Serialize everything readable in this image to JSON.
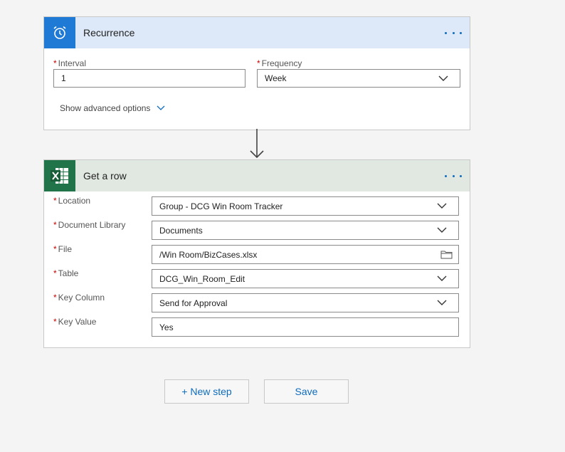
{
  "recurrence": {
    "title": "Recurrence",
    "interval_label": "Interval",
    "interval_value": "1",
    "frequency_label": "Frequency",
    "frequency_value": "Week",
    "advanced_link": "Show advanced options"
  },
  "get_row": {
    "title": "Get a row",
    "fields": [
      {
        "label": "Location",
        "value": "Group - DCG Win Room Tracker",
        "control": "dropdown"
      },
      {
        "label": "Document Library",
        "value": "Documents",
        "control": "dropdown"
      },
      {
        "label": "File",
        "value": "/Win Room/BizCases.xlsx",
        "control": "file-picker"
      },
      {
        "label": "Table",
        "value": "DCG_Win_Room_Edit",
        "control": "dropdown"
      },
      {
        "label": "Key Column",
        "value": "Send for Approval",
        "control": "dropdown"
      },
      {
        "label": "Key Value",
        "value": "Yes",
        "control": "text"
      }
    ]
  },
  "footer": {
    "new_step_label": "+ New step",
    "save_label": "Save"
  },
  "colors": {
    "recurrence_header": "#dde9f9",
    "recurrence_icon_bg": "#1f7ad6",
    "excel_header": "#e1e8e1",
    "excel_icon_bg": "#21734a",
    "accent": "#0f6cbd",
    "required": "#cc0000"
  },
  "icons": {
    "recurrence": "alarm-clock-icon",
    "excel": "excel-icon",
    "more": "ellipsis-icon",
    "dropdown": "chevron-down-icon",
    "folder": "folder-icon",
    "connector": "arrow-down-icon"
  }
}
